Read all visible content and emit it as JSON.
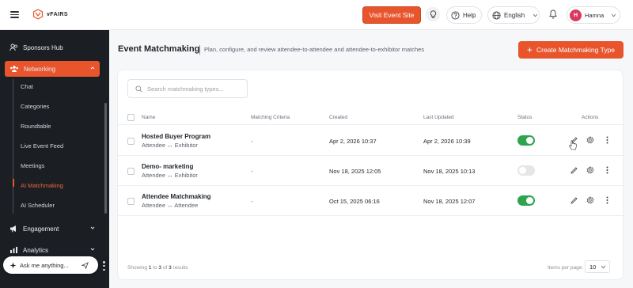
{
  "topbar": {
    "logo_text": "vFAIRS",
    "visit_label": "Visit Event Site",
    "help_label": "Help",
    "language_label": "English",
    "user_initial": "H",
    "user_name": "Hamna"
  },
  "colors": {
    "accent": "#e8552d",
    "sidebar_bg": "#1b1f24",
    "toggle_on": "#2ea44f"
  },
  "sidebar": {
    "top_item": "Sponsors Hub",
    "active_section": "Networking",
    "sub_items": [
      "Chat",
      "Categories",
      "Roundtable",
      "Live Event Feed",
      "Meetings",
      "AI Matchmaking",
      "AI Scheduler"
    ],
    "active_sub": "AI Matchmaking",
    "engagement": "Engagement",
    "analytics": "Analytics",
    "ask_placeholder": "Ask me anything..."
  },
  "page": {
    "title": "Event Matchmaking",
    "subtitle": "Plan, configure, and review attendee-to-attendee and attendee-to-exhibitor matches",
    "create_label": "Create Matchmaking Type",
    "search_placeholder": "Search matchmaking types..."
  },
  "table": {
    "headers": {
      "name": "Name",
      "criteria": "Matching Criteria",
      "created": "Created",
      "updated": "Last Updated",
      "status": "Status",
      "actions": "Actions"
    },
    "rows": [
      {
        "name": "Hosted Buyer Program",
        "type": "Attendee ↔ Exhibitor",
        "criteria": "-",
        "created": "Apr 2, 2026 10:37",
        "updated": "Apr 2, 2026 10:39",
        "status": "on"
      },
      {
        "name": "Demo- marketing",
        "type": "Attendee ↔ Exhibitor",
        "criteria": "-",
        "created": "Nov 18, 2025 12:05",
        "updated": "Nov 18, 2025 10:13",
        "status": "off"
      },
      {
        "name": "Attendee Matchmaking",
        "type": "Attendee ↔ Attendee",
        "criteria": "-",
        "created": "Oct 15, 2025 06:16",
        "updated": "Nov 18, 2025 12:07",
        "status": "on"
      }
    ]
  },
  "footer": {
    "showing_prefix": "Showing",
    "showing_from": "1",
    "showing_to_label": "to",
    "showing_to": "3",
    "showing_of_label": "of",
    "showing_total": "3",
    "showing_suffix": "results",
    "per_page_label": "Items per page:",
    "per_page_value": "10"
  }
}
